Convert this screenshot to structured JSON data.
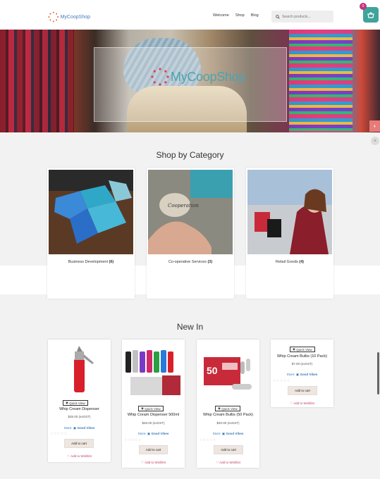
{
  "header": {
    "logo_text": "MyCoopShop",
    "nav": [
      "Welcome",
      "Shop",
      "Blog"
    ],
    "search_placeholder": "Search products...",
    "cart_count": "0"
  },
  "hero": {
    "logo_text": "MyCoopShop"
  },
  "categories": {
    "title": "Shop by Category",
    "items": [
      {
        "name": "Business Development",
        "count": "(6)"
      },
      {
        "name": "Co-operative Services",
        "count": "(3)"
      },
      {
        "name": "Retail Goods",
        "count": "(4)"
      }
    ]
  },
  "new_in": {
    "title": "New In",
    "quick_view": "Quick View",
    "products": [
      {
        "name": "Whip Cream Dispenser",
        "price": "$35.00",
        "tax": "(exGST)",
        "store_label": "Store:",
        "store": "Good Vibes",
        "add_to_cart": "Add to cart",
        "wishlist": "Add to Wishlist"
      },
      {
        "name": "Whip Cream Dispenser 500ml",
        "price": "$45.00",
        "tax": "(exGST)",
        "store_label": "Store:",
        "store": "Good Vibes",
        "add_to_cart": "Add to cart",
        "wishlist": "Add to Wishlist"
      },
      {
        "name": "Whip Cream Bulbs (50 Pack)",
        "price": "$40.00",
        "tax": "(exGST)",
        "store_label": "Store:",
        "store": "Good Vibes",
        "add_to_cart": "Add to cart",
        "wishlist": "Add to Wishlist"
      },
      {
        "name": "Whip Cream Bulbs (10 Pack)",
        "price": "$7.00",
        "tax": "(exGST)",
        "store_label": "Store:",
        "store": "Good Vibes",
        "add_to_cart": "Add to cart",
        "wishlist": "Add to Wishlist"
      }
    ]
  },
  "colors": {
    "accent": "#3fa39b",
    "badge": "#c0357e",
    "store_link": "#3a7ab8",
    "wishlist": "#c04060"
  },
  "icons": [
    "search-icon",
    "cart-icon",
    "eye-icon",
    "heart-icon",
    "star-icon"
  ]
}
